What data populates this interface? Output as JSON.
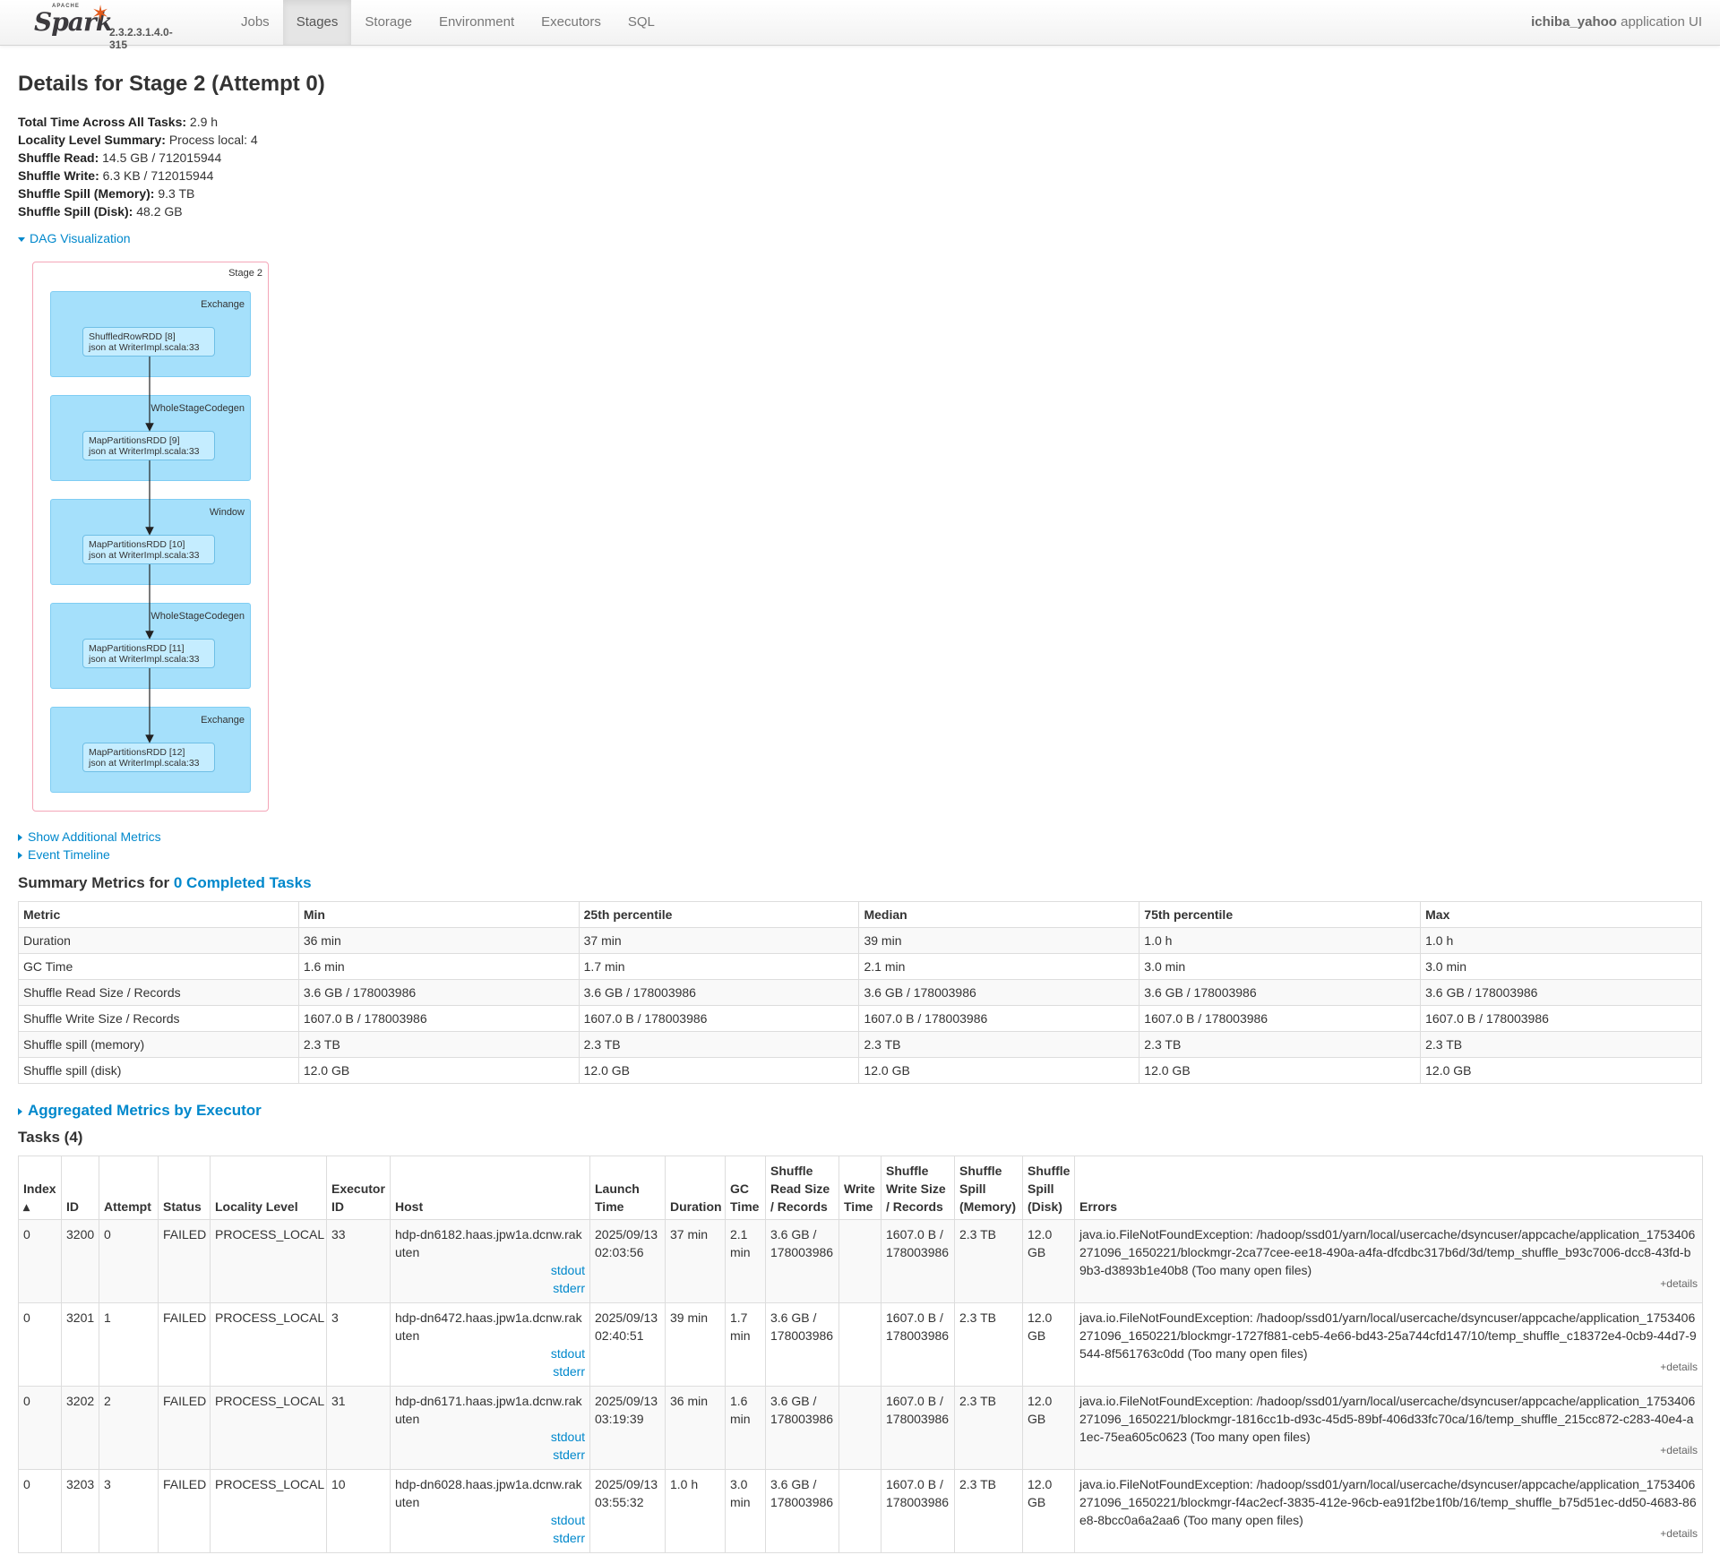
{
  "nav": {
    "brand_apache": "APACHE",
    "brand_name": "Spark",
    "version": "2.3.2.3.1.4.0-315",
    "tabs": [
      "Jobs",
      "Stages",
      "Storage",
      "Environment",
      "Executors",
      "SQL"
    ],
    "active_tab": "Stages",
    "app_name": "ichiba_yahoo",
    "app_suffix": "application UI"
  },
  "title": "Details for Stage 2 (Attempt 0)",
  "summary": [
    {
      "label": "Total Time Across All Tasks:",
      "value": "2.9 h"
    },
    {
      "label": "Locality Level Summary:",
      "value": "Process local: 4"
    },
    {
      "label": "Shuffle Read:",
      "value": "14.5 GB / 712015944"
    },
    {
      "label": "Shuffle Write:",
      "value": "6.3 KB / 712015944"
    },
    {
      "label": "Shuffle Spill (Memory):",
      "value": "9.3 TB"
    },
    {
      "label": "Shuffle Spill (Disk):",
      "value": "48.2 GB"
    }
  ],
  "dag": {
    "toggle_label": "DAG Visualization",
    "stage_label": "Stage 2",
    "clusters": [
      {
        "label": "Exchange",
        "rdd": "ShuffledRowRDD [8]",
        "op": "json at WriterImpl.scala:33"
      },
      {
        "label": "WholeStageCodegen",
        "rdd": "MapPartitionsRDD [9]",
        "op": "json at WriterImpl.scala:33"
      },
      {
        "label": "Window",
        "rdd": "MapPartitionsRDD [10]",
        "op": "json at WriterImpl.scala:33"
      },
      {
        "label": "WholeStageCodegen",
        "rdd": "MapPartitionsRDD [11]",
        "op": "json at WriterImpl.scala:33"
      },
      {
        "label": "Exchange",
        "rdd": "MapPartitionsRDD [12]",
        "op": "json at WriterImpl.scala:33"
      }
    ]
  },
  "toggles": {
    "additional_metrics": "Show Additional Metrics",
    "event_timeline": "Event Timeline",
    "aggregated": "Aggregated Metrics by Executor"
  },
  "summary_metrics": {
    "title_prefix": "Summary Metrics for",
    "title_link": "0 Completed Tasks",
    "headers": [
      "Metric",
      "Min",
      "25th percentile",
      "Median",
      "75th percentile",
      "Max"
    ],
    "rows": [
      [
        "Duration",
        "36 min",
        "37 min",
        "39 min",
        "1.0 h",
        "1.0 h"
      ],
      [
        "GC Time",
        "1.6 min",
        "1.7 min",
        "2.1 min",
        "3.0 min",
        "3.0 min"
      ],
      [
        "Shuffle Read Size / Records",
        "3.6 GB / 178003986",
        "3.6 GB / 178003986",
        "3.6 GB / 178003986",
        "3.6 GB / 178003986",
        "3.6 GB / 178003986"
      ],
      [
        "Shuffle Write Size / Records",
        "1607.0 B / 178003986",
        "1607.0 B / 178003986",
        "1607.0 B / 178003986",
        "1607.0 B / 178003986",
        "1607.0 B / 178003986"
      ],
      [
        "Shuffle spill (memory)",
        "2.3 TB",
        "2.3 TB",
        "2.3 TB",
        "2.3 TB",
        "2.3 TB"
      ],
      [
        "Shuffle spill (disk)",
        "12.0 GB",
        "12.0 GB",
        "12.0 GB",
        "12.0 GB",
        "12.0 GB"
      ]
    ]
  },
  "tasks": {
    "title": "Tasks (4)",
    "headers": [
      "Index ▴",
      "ID",
      "Attempt",
      "Status",
      "Locality Level",
      "Executor ID",
      "Host",
      "Launch Time",
      "Duration",
      "GC Time",
      "Shuffle Read Size / Records",
      "Write Time",
      "Shuffle Write Size / Records",
      "Shuffle Spill (Memory)",
      "Shuffle Spill (Disk)",
      "Errors"
    ],
    "stdout_label": "stdout",
    "stderr_label": "stderr",
    "details_label": "+details",
    "rows": [
      {
        "index": "0",
        "id": "3200",
        "attempt": "0",
        "status": "FAILED",
        "locality": "PROCESS_LOCAL",
        "executor": "33",
        "host": "hdp-dn6182.haas.jpw1a.dcnw.rakuten",
        "launch": "2025/09/13 02:03:56",
        "duration": "37 min",
        "gc": "2.1 min",
        "read": "3.6 GB / 178003986",
        "write_time": "",
        "write": "1607.0 B / 178003986",
        "spill_mem": "2.3 TB",
        "spill_disk": "12.0 GB",
        "error": "java.io.FileNotFoundException: /hadoop/ssd01/yarn/local/usercache/dsyncuser/appcache/application_1753406271096_1650221/blockmgr-2ca77cee-ee18-490a-a4fa-dfcdbc317b6d/3d/temp_shuffle_b93c7006-dcc8-43fd-b9b3-d3893b1e40b8 (Too many open files)"
      },
      {
        "index": "0",
        "id": "3201",
        "attempt": "1",
        "status": "FAILED",
        "locality": "PROCESS_LOCAL",
        "executor": "3",
        "host": "hdp-dn6472.haas.jpw1a.dcnw.rakuten",
        "launch": "2025/09/13 02:40:51",
        "duration": "39 min",
        "gc": "1.7 min",
        "read": "3.6 GB / 178003986",
        "write_time": "",
        "write": "1607.0 B / 178003986",
        "spill_mem": "2.3 TB",
        "spill_disk": "12.0 GB",
        "error": "java.io.FileNotFoundException: /hadoop/ssd01/yarn/local/usercache/dsyncuser/appcache/application_1753406271096_1650221/blockmgr-1727f881-ceb5-4e66-bd43-25a744cfd147/10/temp_shuffle_c18372e4-0cb9-44d7-9544-8f561763c0dd (Too many open files)"
      },
      {
        "index": "0",
        "id": "3202",
        "attempt": "2",
        "status": "FAILED",
        "locality": "PROCESS_LOCAL",
        "executor": "31",
        "host": "hdp-dn6171.haas.jpw1a.dcnw.rakuten",
        "launch": "2025/09/13 03:19:39",
        "duration": "36 min",
        "gc": "1.6 min",
        "read": "3.6 GB / 178003986",
        "write_time": "",
        "write": "1607.0 B / 178003986",
        "spill_mem": "2.3 TB",
        "spill_disk": "12.0 GB",
        "error": "java.io.FileNotFoundException: /hadoop/ssd01/yarn/local/usercache/dsyncuser/appcache/application_1753406271096_1650221/blockmgr-1816cc1b-d93c-45d5-89bf-406d33fc70ca/16/temp_shuffle_215cc872-c283-40e4-a1ec-75ea605c0623 (Too many open files)"
      },
      {
        "index": "0",
        "id": "3203",
        "attempt": "3",
        "status": "FAILED",
        "locality": "PROCESS_LOCAL",
        "executor": "10",
        "host": "hdp-dn6028.haas.jpw1a.dcnw.rakuten",
        "launch": "2025/09/13 03:55:32",
        "duration": "1.0 h",
        "gc": "3.0 min",
        "read": "3.6 GB / 178003986",
        "write_time": "",
        "write": "1607.0 B / 178003986",
        "spill_mem": "2.3 TB",
        "spill_disk": "12.0 GB",
        "error": "java.io.FileNotFoundException: /hadoop/ssd01/yarn/local/usercache/dsyncuser/appcache/application_1753406271096_1650221/blockmgr-f4ac2ecf-3835-412e-96cb-ea91f2be1f0b/16/temp_shuffle_b75d51ec-dd50-4683-86e8-8bcc0a6a2aa6 (Too many open files)"
      }
    ]
  }
}
